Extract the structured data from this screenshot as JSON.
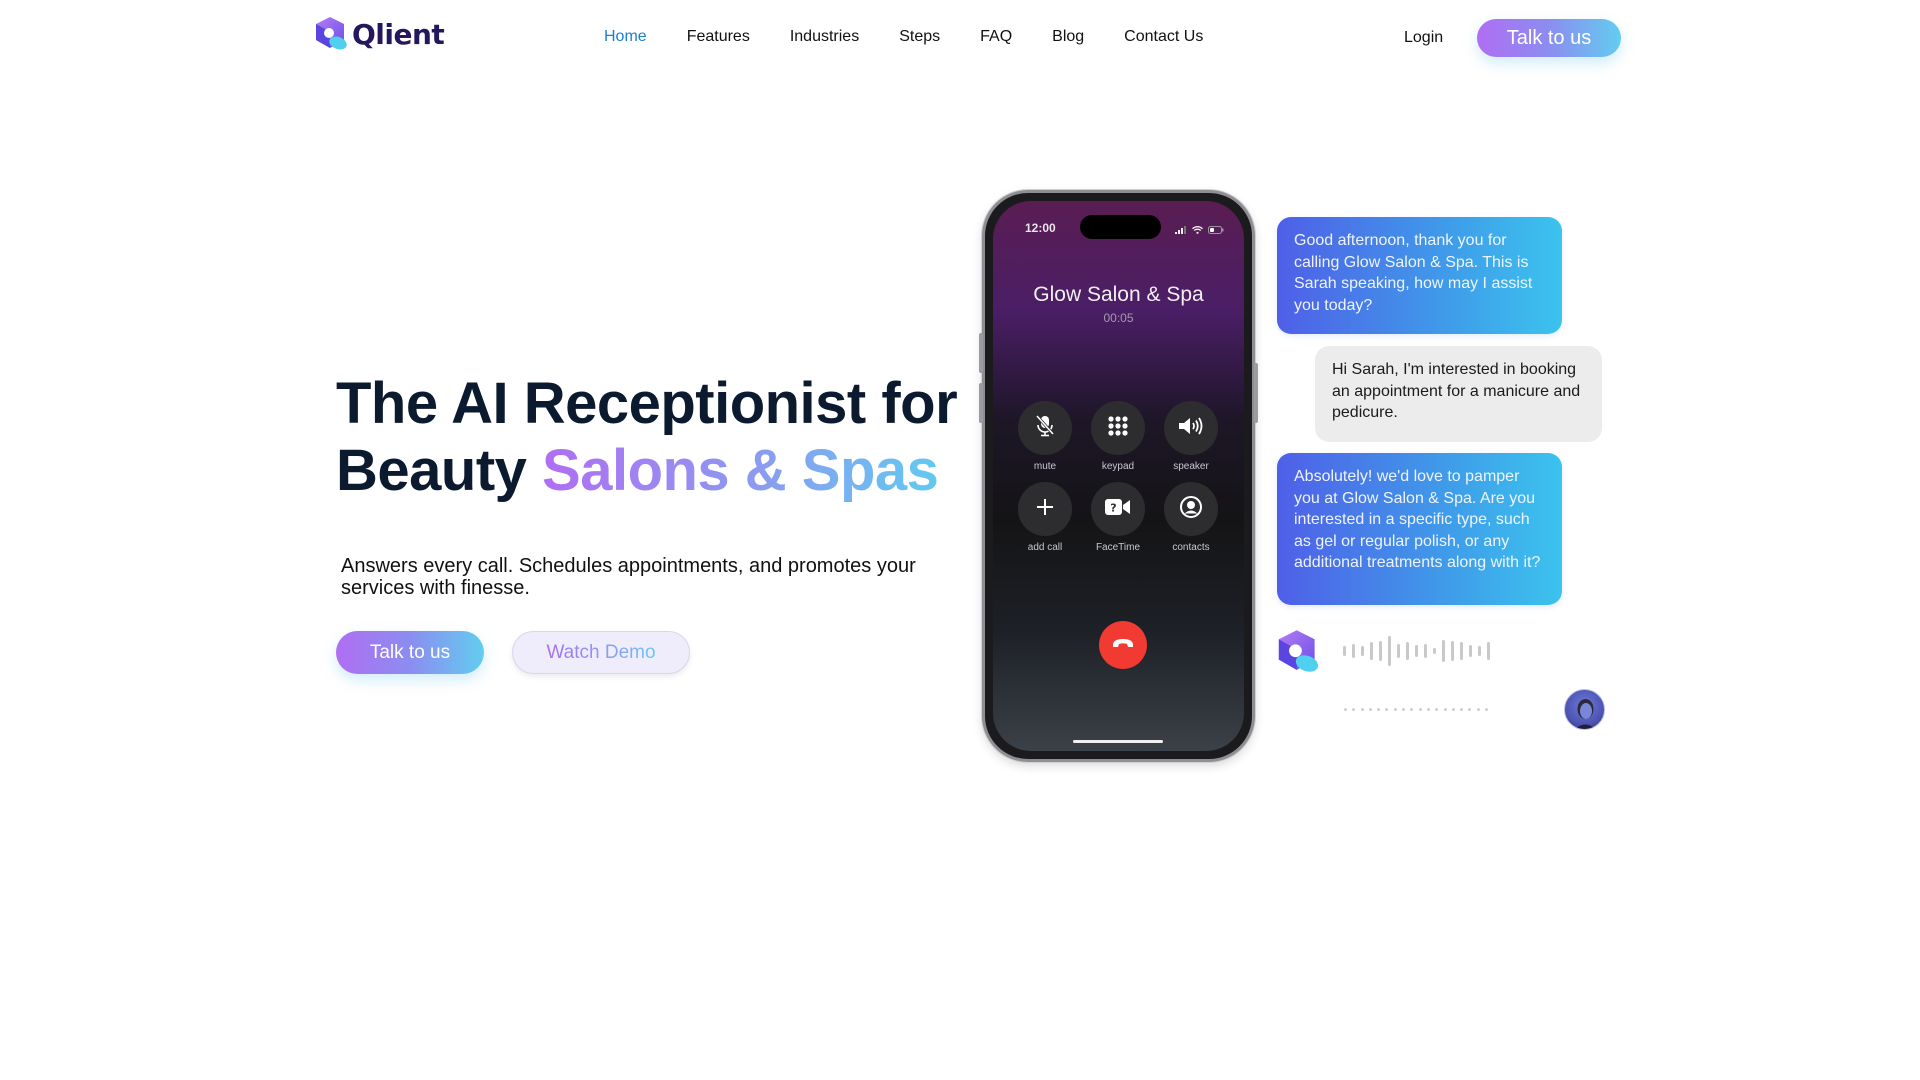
{
  "nav": {
    "brand": "Qlient",
    "links": [
      {
        "label": "Home",
        "active": true
      },
      {
        "label": "Features",
        "active": false
      },
      {
        "label": "Industries",
        "active": false
      },
      {
        "label": "Steps",
        "active": false
      },
      {
        "label": "FAQ",
        "active": false
      },
      {
        "label": "Blog",
        "active": false
      },
      {
        "label": "Contact Us",
        "active": false
      }
    ],
    "login_label": "Login",
    "cta_label": "Talk to us"
  },
  "hero": {
    "title_line1": "The AI Receptionist for",
    "title_line2_plain": "Beauty ",
    "title_line2_highlight": "Salons & Spas",
    "subtitle": "Answers every call. Schedules appointments, and promotes your services with finesse.",
    "primary_cta": "Talk to us",
    "secondary_cta": "Watch Demo"
  },
  "phone": {
    "status_time": "12:00",
    "caller_name": "Glow Salon & Spa",
    "call_duration": "00:05",
    "controls": [
      {
        "label": "mute",
        "icon": "mic-off-icon"
      },
      {
        "label": "keypad",
        "icon": "keypad-icon"
      },
      {
        "label": "speaker",
        "icon": "speaker-icon"
      },
      {
        "label": "add call",
        "icon": "plus-icon"
      },
      {
        "label": "FaceTime",
        "icon": "facetime-icon"
      },
      {
        "label": "contacts",
        "icon": "contact-icon"
      }
    ],
    "end_call_icon": "end-call-icon"
  },
  "chat": {
    "messages": [
      {
        "sender": "ai",
        "text": "Good afternoon, thank you for calling Glow Salon & Spa. This is Sarah speaking, how may I assist you today?"
      },
      {
        "sender": "user",
        "text": "Hi Sarah, I'm interested in booking an appointment for a manicure and pedicure."
      },
      {
        "sender": "ai",
        "text": "Absolutely! we'd love to pamper you at Glow Salon & Spa. Are you interested in a specific type, such as gel or regular polish, or any additional treatments along with it?"
      }
    ]
  },
  "colors": {
    "nav_active": "#1b7fd4",
    "heading": "#0b1a2e",
    "brand_text": "#25175e",
    "gradient_start": "#b06ef3",
    "gradient_end": "#62cdf0",
    "ai_bubble_start": "#4f5fe8",
    "ai_bubble_end": "#3bc3ee",
    "user_bubble": "#ececec",
    "end_call": "#f03a32"
  }
}
